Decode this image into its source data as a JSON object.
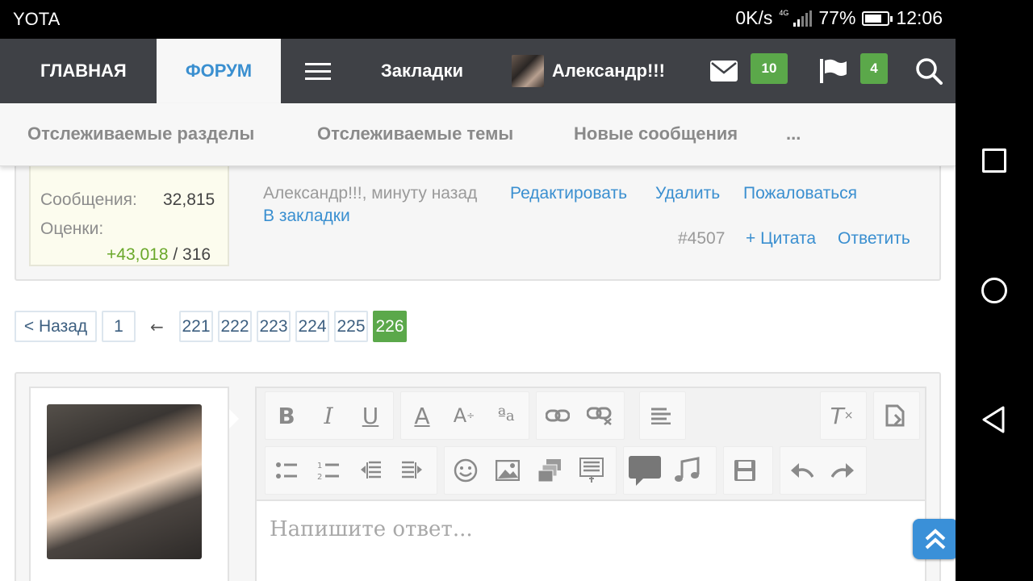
{
  "status_bar": {
    "carrier": "YOTA",
    "speed": "0K/s",
    "network": "4G",
    "battery": "77%",
    "battery_level": 0.77,
    "time": "12:06"
  },
  "top_nav": {
    "home": "ГЛАВНАЯ",
    "forum": "ФОРУМ",
    "bookmarks": "Закладки",
    "username": "Александр!!!",
    "mail_count": "10",
    "alerts_count": "4"
  },
  "sub_nav": {
    "watched_forums": "Отслеживаемые разделы",
    "watched_threads": "Отслеживаемые темы",
    "new_posts": "Новые сообщения",
    "more": "..."
  },
  "user_stats": {
    "messages_label": "Сообщения:",
    "messages_value": "32,815",
    "ratings_label": "Оценки:",
    "ratings_positive": "+43,018",
    "ratings_rest": "/ 316"
  },
  "post": {
    "meta": "Александр!!!, минуту назад",
    "edit": "Редактировать",
    "delete": "Удалить",
    "report": "Пожаловаться",
    "bookmark": "В закладки",
    "number": "#4507",
    "quote": "+ Цитата",
    "reply": "Ответить"
  },
  "pagination": {
    "back": "< Назад",
    "first": "1",
    "arrow": "←",
    "pages": [
      "221",
      "222",
      "223",
      "224",
      "225"
    ],
    "current": "226"
  },
  "editor": {
    "placeholder": "Напишите ответ..."
  },
  "colors": {
    "accent": "#3a8fd0",
    "badge": "#5ba84a",
    "nav_bg": "#3f4146"
  }
}
